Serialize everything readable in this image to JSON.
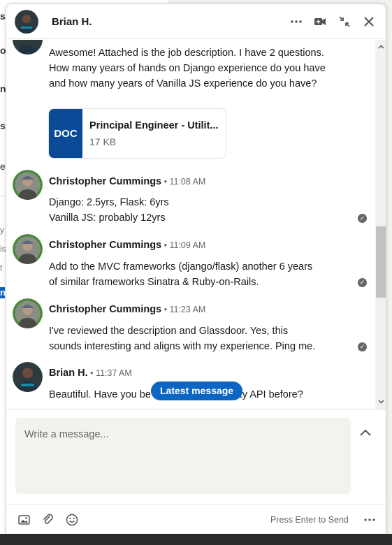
{
  "background_fragments": [
    "se",
    "o",
    "nc",
    "s",
    "e",
    "y",
    "is",
    "t",
    "n"
  ],
  "window": {
    "title": "Brian H."
  },
  "messages": [
    {
      "text": "Awesome! Attached is the job description. I have 2 questions. How many years of hands on Django experience do you have and how many years of Vanilla JS experience do you have?",
      "attachment": {
        "badge": "DOC",
        "name": "Principal Engineer - Utilit...",
        "size": "17 KB"
      }
    },
    {
      "sender": "Christopher Cummings",
      "time": " • 11:08 AM",
      "lines": [
        "Django: 2.5yrs, Flask: 6yrs",
        "Vanilla JS: probably 12yrs"
      ]
    },
    {
      "sender": "Christopher Cummings",
      "time": " • 11:09 AM",
      "lines": [
        "Add to the MVC frameworks (django/flask) another 6 years",
        "of similar frameworks Sinatra & Ruby-on-Rails."
      ]
    },
    {
      "sender": "Christopher Cummings",
      "time": " • 11:23 AM",
      "lines": [
        "I've reviewed the description and Glassdoor. Yes, this",
        "sounds interesting and aligns with my experience. Ping me."
      ]
    },
    {
      "sender": "Brian H.",
      "time": " • 11:37 AM",
      "text_left": "Beautiful. Have you be",
      "text_right": "tility API before?"
    }
  ],
  "latest_button": "Latest message",
  "compose": {
    "placeholder": "Write a message..."
  },
  "footer": {
    "hint": "Press Enter to Send"
  },
  "colors": {
    "accent": "#0a66c2",
    "doc": "#0a4a96"
  }
}
